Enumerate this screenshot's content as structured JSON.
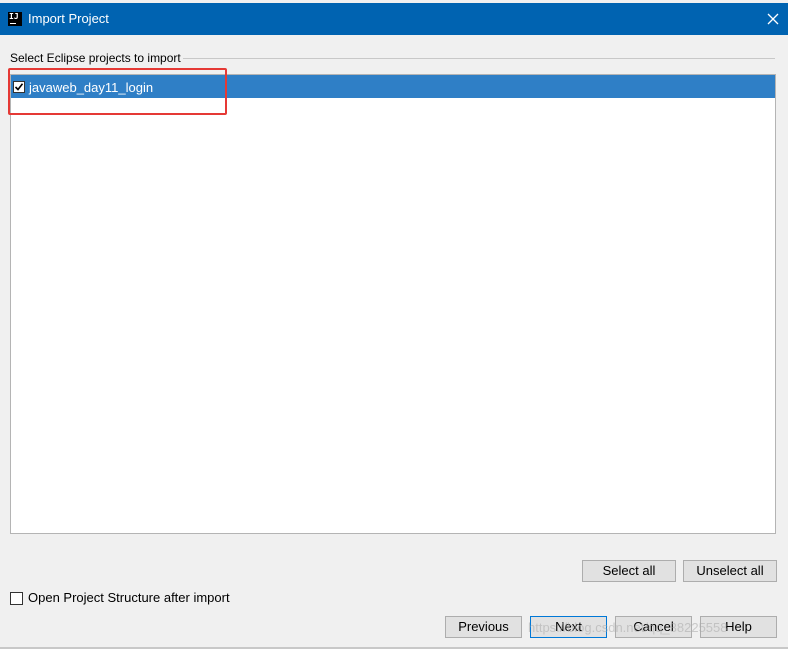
{
  "window": {
    "title": "Import Project",
    "app_icon_text": "IJ",
    "app_icon": "intellij-icon",
    "close_icon": "close-icon",
    "title_bar_color": "#0063b1"
  },
  "projects": {
    "section_label": "Select Eclipse projects to import",
    "items": [
      {
        "label": "javaweb_day11_login",
        "checked": true,
        "selected": true
      }
    ],
    "selected_row_color": "#2f7fc6"
  },
  "annotation": {
    "highlight_color": "#e53935"
  },
  "selection_buttons": {
    "select_all": "Select all",
    "unselect_all": "Unselect all"
  },
  "options": {
    "open_structure_label": "Open Project Structure after import",
    "open_structure_checked": false
  },
  "footer": {
    "previous": "Previous",
    "next": "Next",
    "cancel": "Cancel",
    "help": "Help"
  },
  "watermark": {
    "text": "https://blog.csdn.net/qq_38225558"
  }
}
